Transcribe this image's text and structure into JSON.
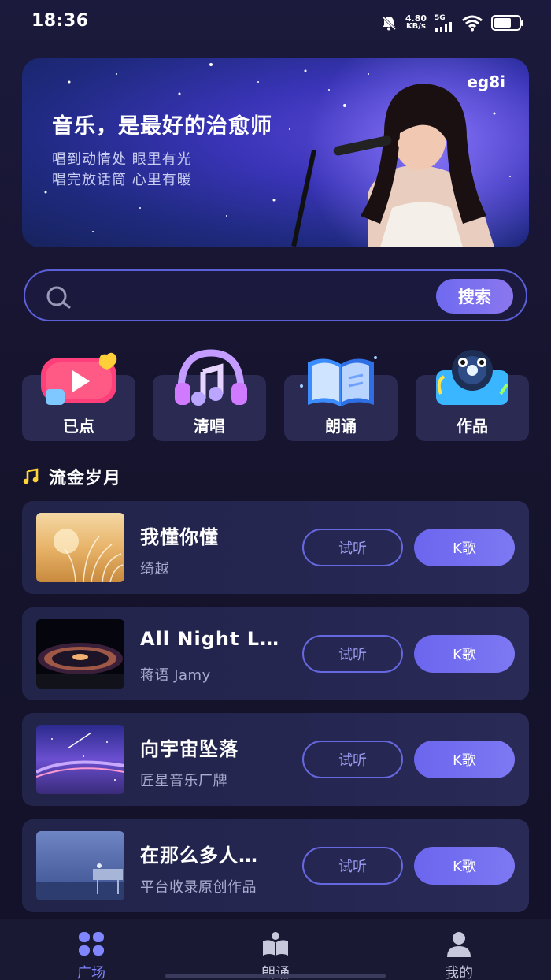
{
  "status_bar": {
    "time": "18:36",
    "speed_value": "4.80",
    "speed_unit": "KB/s",
    "network": "5G",
    "icons": [
      "mute-bell-icon",
      "signal-icon",
      "wifi-icon",
      "battery-icon"
    ]
  },
  "banner": {
    "title": "音乐，是最好的治愈师",
    "line1": "唱到动情处  眼里有光",
    "line2": "唱完放话筒  心里有暖",
    "logo": "eg8i"
  },
  "search": {
    "placeholder": "",
    "button_label": "搜索"
  },
  "categories": [
    {
      "label": "已点",
      "icon": "video-heart-icon"
    },
    {
      "label": "清唱",
      "icon": "headphones-note-icon"
    },
    {
      "label": "朗诵",
      "icon": "open-book-icon"
    },
    {
      "label": "作品",
      "icon": "vinyl-player-icon"
    }
  ],
  "section": {
    "title": "流金岁月",
    "icon": "music-note-icon"
  },
  "songs": [
    {
      "title": "我懂你懂",
      "artist": "绮越",
      "listen_label": "试听",
      "ktv_label": "K歌"
    },
    {
      "title": "All Night L…",
      "artist": "蒋语 Jamy",
      "listen_label": "试听",
      "ktv_label": "K歌"
    },
    {
      "title": "向宇宙坠落",
      "artist": "匠星音乐厂牌",
      "listen_label": "试听",
      "ktv_label": "K歌"
    },
    {
      "title": "在那么多人…",
      "artist": "平台收录原创作品",
      "listen_label": "试听",
      "ktv_label": "K歌"
    }
  ],
  "bottom_nav": [
    {
      "label": "广场",
      "icon": "grid-icon",
      "active": true
    },
    {
      "label": "朗诵",
      "icon": "book-icon",
      "active": false
    },
    {
      "label": "我的",
      "icon": "user-icon",
      "active": false
    }
  ],
  "colors": {
    "accent": "#6b66ee",
    "active_nav": "#7f86ff",
    "background": "#16142e",
    "card": "#2a2a52"
  }
}
